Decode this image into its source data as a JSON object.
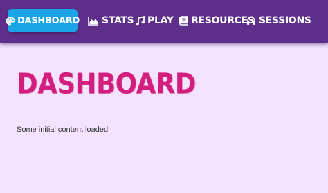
{
  "nav": {
    "items": [
      {
        "label": "DASHBOARD",
        "icon": "palette-icon"
      },
      {
        "label": "STATS",
        "icon": "area-chart-icon"
      },
      {
        "label": "PLAY",
        "icon": "music-icon"
      },
      {
        "label": "RESOURCES",
        "icon": "book-icon"
      },
      {
        "label": "SESSIONS",
        "icon": "headphones-icon"
      }
    ],
    "active": "DASHBOARD"
  },
  "main": {
    "title": "DASHBOARD",
    "content": "Some initial content loaded"
  },
  "colors": {
    "navbar": "#5e2e8b",
    "active_tab": "#1aa4e6",
    "background": "#f4e3ff",
    "title": "#d41e7e"
  }
}
